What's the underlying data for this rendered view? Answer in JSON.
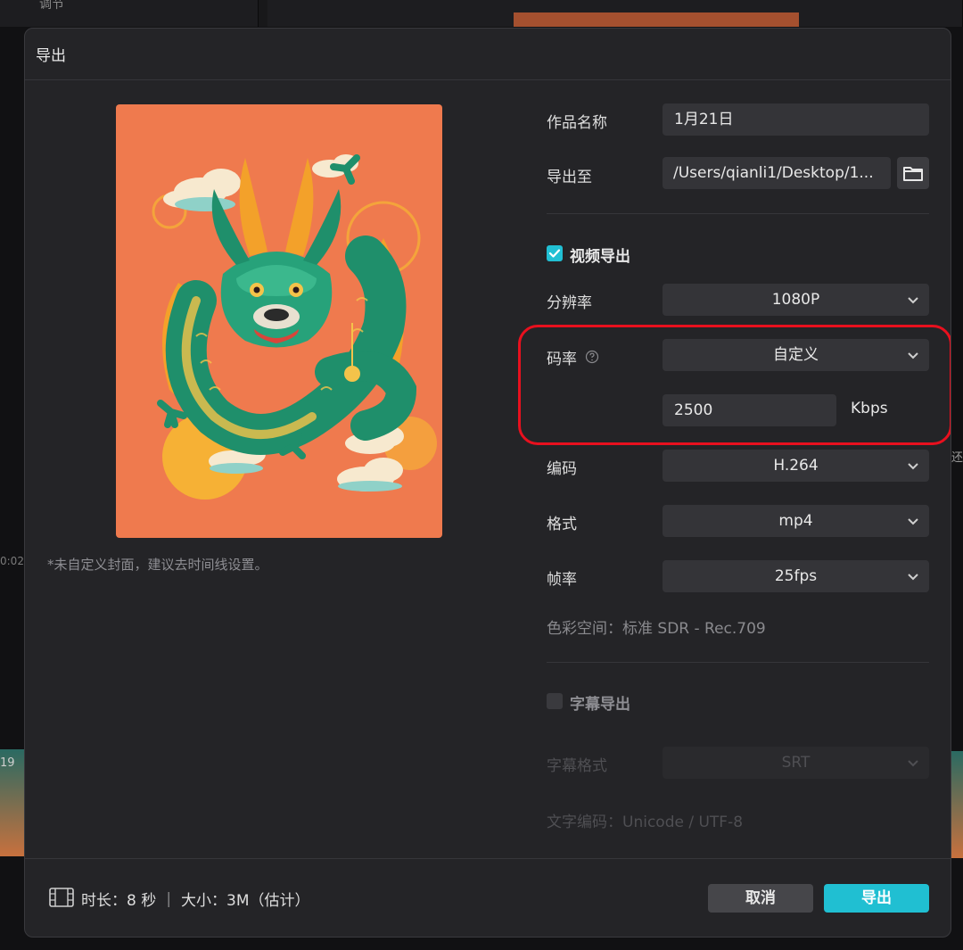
{
  "background": {
    "top_label": "调节",
    "left_time": "0:02",
    "left_clip_label": "19",
    "right_label": "还"
  },
  "dialog": {
    "title": "导出",
    "cover_note": "*未自定义封面，建议去时间线设置。",
    "name_label": "作品名称",
    "name_value": "1月21日",
    "export_to_label": "导出至",
    "export_path": "/Users/qianli1/Desktop/1...",
    "video_export_label": "视频导出",
    "video_export_checked": true,
    "resolution_label": "分辨率",
    "resolution_value": "1080P",
    "bitrate_label": "码率",
    "bitrate_value": "自定义",
    "bitrate_custom_value": "2500",
    "bitrate_unit": "Kbps",
    "codec_label": "编码",
    "codec_value": "H.264",
    "format_label": "格式",
    "format_value": "mp4",
    "framerate_label": "帧率",
    "framerate_value": "25fps",
    "color_space": "色彩空间：标准 SDR - Rec.709",
    "subtitle_export_label": "字幕导出",
    "subtitle_export_checked": false,
    "subtitle_format_label": "字幕格式",
    "subtitle_format_value": "SRT",
    "text_encoding": "文字编码：Unicode / UTF-8",
    "footer_info": "时长：8 秒 ｜ 大小：3M（估计）",
    "cancel_label": "取消",
    "export_label": "导出"
  },
  "colors": {
    "accent": "#20bfd2",
    "highlight": "#e8101e",
    "preview_bg": "#ef7a4e"
  }
}
